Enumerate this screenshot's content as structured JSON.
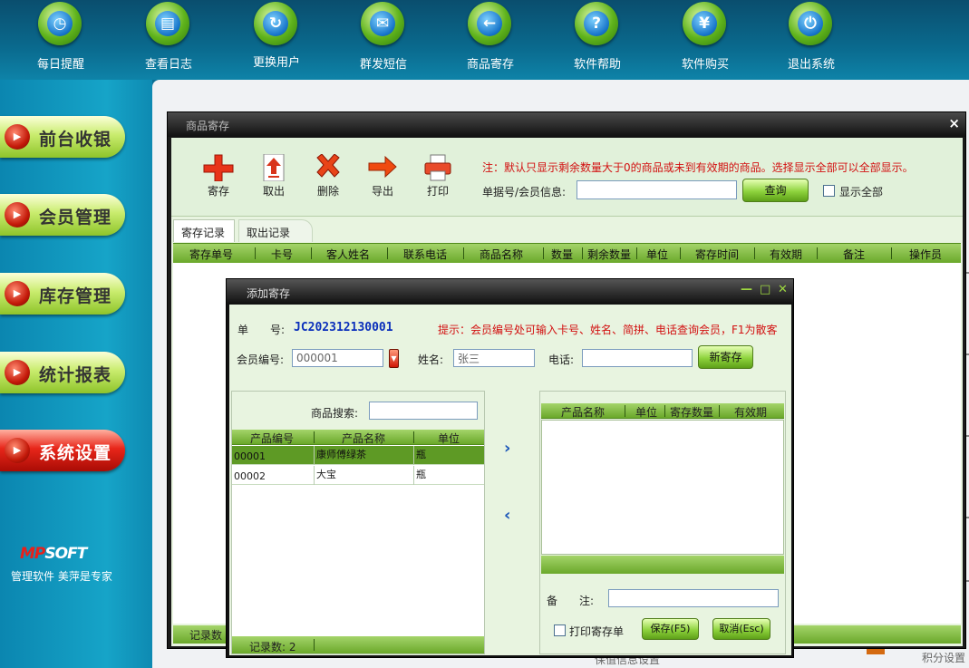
{
  "toolbar": {
    "items": [
      {
        "label": "每日提醒",
        "icon": "clock-icon",
        "glyph": "◷"
      },
      {
        "label": "查看日志",
        "icon": "log-icon",
        "glyph": "▤"
      },
      {
        "label": "更换用户",
        "icon": "switch-user-icon",
        "glyph": "↻"
      },
      {
        "label": "群发短信",
        "icon": "sms-icon",
        "glyph": "✉"
      },
      {
        "label": "商品寄存",
        "icon": "deposit-icon",
        "glyph": "←"
      },
      {
        "label": "软件帮助",
        "icon": "help-icon",
        "glyph": "?"
      },
      {
        "label": "软件购买",
        "icon": "purchase-icon",
        "glyph": "¥"
      },
      {
        "label": "退出系统",
        "icon": "power-icon",
        "glyph": "⏻"
      }
    ]
  },
  "sidebar": {
    "items": [
      {
        "label": "前台收银",
        "active": false
      },
      {
        "label": "会员管理",
        "active": false
      },
      {
        "label": "库存管理",
        "active": false
      },
      {
        "label": "统计报表",
        "active": false
      },
      {
        "label": "系统设置",
        "active": true
      }
    ],
    "logo_a": "MP",
    "logo_b": "SOFT",
    "slogan": "管理软件  美萍是专家"
  },
  "background": {
    "text1": "保值信息设置",
    "text2": "积分设置"
  },
  "deposit_window": {
    "title": "商品寄存",
    "close": "×",
    "tools": [
      {
        "label": "寄存",
        "icon": "add-icon"
      },
      {
        "label": "取出",
        "icon": "take-out-icon"
      },
      {
        "label": "删除",
        "icon": "delete-icon"
      },
      {
        "label": "导出",
        "icon": "export-icon"
      },
      {
        "label": "打印",
        "icon": "print-icon"
      }
    ],
    "note": "注：默认只显示剩余数量大于0的商品或未到有效期的商品。选择显示全部可以全部显示。",
    "query_label": "单据号/会员信息:",
    "query_value": "",
    "query_button": "查询",
    "show_all_label": "显示全部",
    "show_all_checked": false,
    "tabs": [
      "寄存记录",
      "取出记录"
    ],
    "columns": [
      "寄存单号",
      "卡号",
      "客人姓名",
      "联系电话",
      "商品名称",
      "数量",
      "剩余数量",
      "单位",
      "寄存时间",
      "有效期",
      "备注",
      "操作员"
    ],
    "footer": "记录数"
  },
  "add_window": {
    "title": "添加寄存",
    "controls": [
      "—",
      "□",
      "✕"
    ],
    "order_label": "单　　号:",
    "order_no": "JC202312130001",
    "hint": "提示：会员编号处可输入卡号、姓名、简拼、电话查询会员，F1为散客",
    "member_label": "会员编号:",
    "member_value": "000001",
    "name_label": "姓名:",
    "name_value": "张三",
    "phone_label": "电话:",
    "phone_value": "",
    "new_button": "新寄存",
    "search_label": "商品搜索:",
    "search_value": "",
    "left_columns": [
      "产品编号",
      "产品名称",
      "单位"
    ],
    "products": [
      {
        "code": "00001",
        "name": "康师傅绿茶",
        "unit": "瓶",
        "selected": true
      },
      {
        "code": "00002",
        "name": "大宝",
        "unit": "瓶",
        "selected": false
      }
    ],
    "record_count": "记录数: 2",
    "right_columns": [
      "产品名称",
      "单位",
      "寄存数量",
      "有效期"
    ],
    "remark_label": "备　　注:",
    "remark_value": "",
    "print_label": "打印寄存单",
    "print_checked": false,
    "save_button": "保存(F5)",
    "cancel_button": "取消(Esc)",
    "arrow_right": "›",
    "arrow_left": "‹"
  },
  "colors": {
    "accent_green": "#8ed33d",
    "header_green": "#6aa82a",
    "alert_red": "#d21010",
    "order_blue": "#0a2fbb"
  }
}
